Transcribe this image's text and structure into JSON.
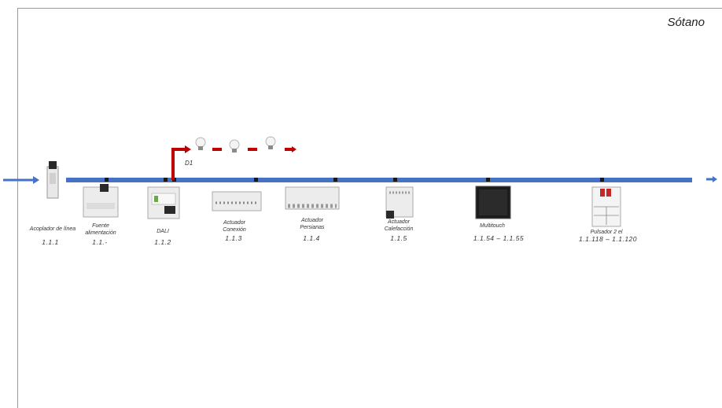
{
  "floor": {
    "title": "Sótano"
  },
  "dali": {
    "line_label": "D1"
  },
  "devices": [
    {
      "id": "acoplador",
      "name": "Acoplador de línea",
      "address": "1.1.1"
    },
    {
      "id": "fuente",
      "name": "Fuente alimentación",
      "address": "1.1.-"
    },
    {
      "id": "dali",
      "name": "DALI",
      "address": "1.1.2"
    },
    {
      "id": "conexion",
      "name": "Actuador Conexión",
      "address": "1.1.3"
    },
    {
      "id": "persianas",
      "name": "Actuador Persianas",
      "address": "1.1.4"
    },
    {
      "id": "calefaccion",
      "name": "Actuador Calefacción",
      "address": "1.1.5"
    },
    {
      "id": "multitouch",
      "name": "Multitouch",
      "address": "1.1.54 – 1.1.55"
    },
    {
      "id": "pulsador",
      "name": "Pulsador 2 el",
      "address": "1.1.118  –  1.1.120"
    }
  ],
  "colors": {
    "bus": "#4472c4",
    "dali_line": "#c00000",
    "frame": "#9a9a9a"
  }
}
